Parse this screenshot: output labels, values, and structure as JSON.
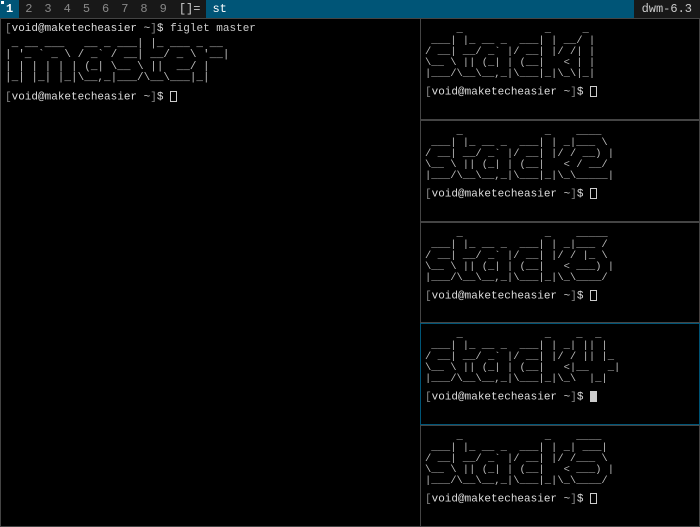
{
  "topbar": {
    "tags": [
      "1",
      "2",
      "3",
      "4",
      "5",
      "6",
      "7",
      "8",
      "9"
    ],
    "active_tag_index": 0,
    "layout_symbol": "[]=",
    "title": "st",
    "status": "dwm-6.3"
  },
  "prompt": {
    "open_bracket": "[",
    "user_host": "void@maketecheasier",
    "cwd": "~",
    "close_bracket": "]",
    "dollar": "$"
  },
  "master": {
    "command": "figlet master",
    "ascii": " _ __ ___   __ _ ___| |_ ___ _ __\n| '_ ` _ \\ / _` / __| __/ _ \\ '__|\n| | | | | | (_| \\__ \\ ||  __/ |\n|_| |_| |_|\\__,_|___/\\__\\___|_|"
  },
  "stacks": [
    {
      "ascii": "     _             _     _\n ___| |_ __ _  ___| | __/ |\n/ __| __/ _` |/ __| |/ /| |\n\\__ \\ || (_| | (__|   < | |\n|___/\\__\\__,_|\\___|_|\\_\\|_|"
    },
    {
      "ascii": "     _             _    ____\n ___| |_ __ _  ___| | _|___ \\\n/ __| __/ _` |/ __| |/ / __) |\n\\__ \\ || (_| | (__|   < / __/\n|___/\\__\\__,_|\\___|_|\\_\\_____|"
    },
    {
      "ascii": "     _             _    _____\n ___| |_ __ _  ___| | _|___ /\n/ __| __/ _` |/ __| |/ / |_ \\\n\\__ \\ || (_| | (__|   < ___) |\n|___/\\__\\__,_|\\___|_|\\_\\____/"
    },
    {
      "ascii": "     _             _    _  _\n ___| |_ __ _  ___| | _| || |\n/ __| __/ _` |/ __| |/ / || |_\n\\__ \\ || (_| | (__|   <|__   _|\n|___/\\__\\__,_|\\___|_|\\_\\  |_|"
    },
    {
      "ascii": "     _             _    ____\n ___| |_ __ _  ___| | _| ___|\n/ __| __/ _` |/ __| |/ /___ \\\n\\__ \\ || (_| | (__|   < ___) |\n|___/\\__\\__,_|\\___|_|\\_\\____/"
    }
  ],
  "focused_stack_index": 3
}
